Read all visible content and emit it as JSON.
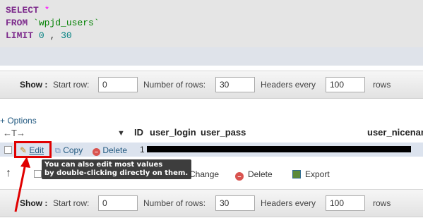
{
  "sql": {
    "line1_kw": "SELECT",
    "line1_op": "*",
    "line2_kw": "FROM",
    "line2_table": "`wpjd_users`",
    "line3_kw": "LIMIT",
    "line3_start": "0",
    "line3_sep": ",",
    "line3_count": "30"
  },
  "nav_top": {
    "show_label": "Show :",
    "start_row_label": "Start row:",
    "start_row_value": "0",
    "num_rows_label": "Number of rows:",
    "num_rows_value": "30",
    "headers_label": "Headers every",
    "headers_value": "100",
    "rows_label": "rows"
  },
  "nav_bottom": {
    "show_label": "Show :",
    "start_row_label": "Start row:",
    "start_row_value": "0",
    "num_rows_label": "Number of rows:",
    "num_rows_value": "30",
    "headers_label": "Headers every",
    "headers_value": "100",
    "rows_label": "rows"
  },
  "options_link": "+ Options",
  "columns": [
    "ID",
    "user_login",
    "user_pass",
    "user_nicenam"
  ],
  "row_actions": {
    "edit": "Edit",
    "copy": "Copy",
    "delete": "Delete",
    "id_value": "1"
  },
  "tooltip": {
    "line1": "You can also edit most values",
    "line2": "by double-clicking directly on them."
  },
  "bulk_actions": {
    "change": "Change",
    "delete": "Delete",
    "export": "Export"
  },
  "colors": {
    "highlight": "#e00000",
    "link": "#235a81",
    "row_bg": "#dce3ee"
  }
}
